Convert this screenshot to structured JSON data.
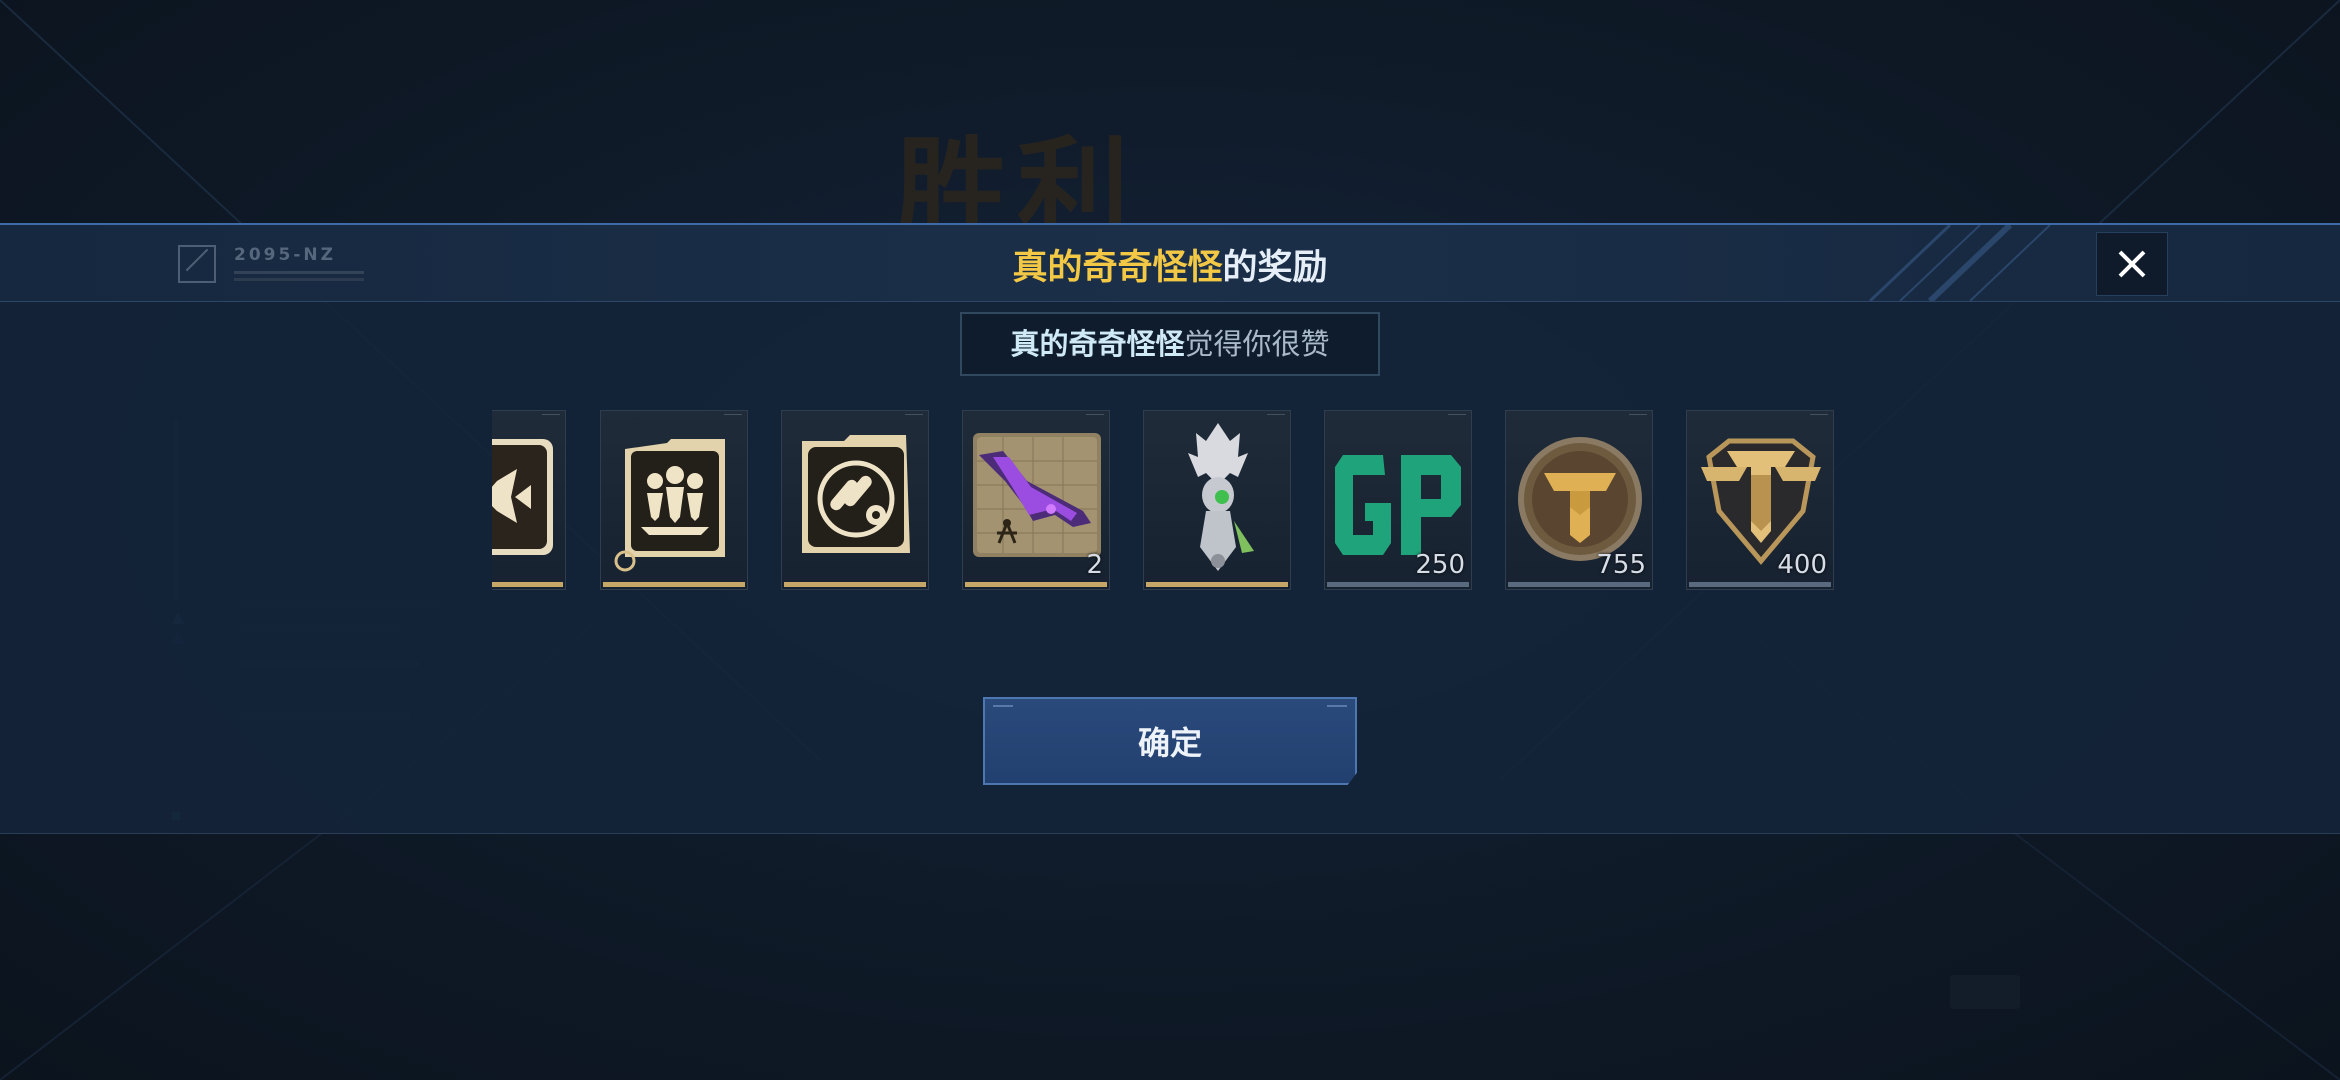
{
  "background": {
    "victory_text": "胜利"
  },
  "header": {
    "logo_text": "2095-NZ",
    "title_name": "真的奇奇怪怪",
    "title_suffix": "的奖励"
  },
  "subtitle": {
    "name": "真的奇奇怪怪",
    "suffix": "觉得你很赞"
  },
  "rewards": [
    {
      "icon": "fish-blueprint-icon",
      "count": "",
      "frame": "gold"
    },
    {
      "icon": "squad-emblem-icon",
      "count": "",
      "frame": "gold"
    },
    {
      "icon": "bullet-ammo-icon",
      "count": "",
      "frame": "gold"
    },
    {
      "icon": "purple-rifle-blueprint-icon",
      "count": "2",
      "frame": "gold"
    },
    {
      "icon": "alien-ornament-icon",
      "count": "",
      "frame": "gold"
    },
    {
      "icon": "gp-currency-icon",
      "count": "250",
      "frame": "grey"
    },
    {
      "icon": "gold-medal-coin-icon",
      "count": "755",
      "frame": "grey"
    },
    {
      "icon": "gold-shield-badge-icon",
      "count": "400",
      "frame": "grey"
    }
  ],
  "confirm_label": "确定",
  "colors": {
    "accent_gold": "#f3c845",
    "frame_gold": "#c7a768",
    "button_blue": "#2a4a7c"
  }
}
